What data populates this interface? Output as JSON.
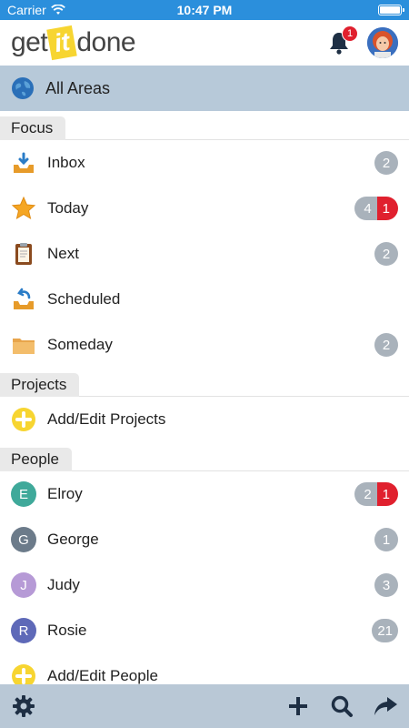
{
  "status_bar": {
    "carrier": "Carrier",
    "time": "10:47 PM"
  },
  "header": {
    "logo_pre": "get",
    "logo_it": "it",
    "logo_post": "done",
    "notification_count": "1"
  },
  "all_areas": {
    "label": "All Areas"
  },
  "focus": {
    "title": "Focus",
    "items": [
      {
        "label": "Inbox",
        "icon": "inbox-icon",
        "count": "2"
      },
      {
        "label": "Today",
        "icon": "star-icon",
        "count": "4",
        "overdue": "1"
      },
      {
        "label": "Next",
        "icon": "clipboard-icon",
        "count": "2"
      },
      {
        "label": "Scheduled",
        "icon": "scheduled-tray-icon",
        "count": ""
      },
      {
        "label": "Someday",
        "icon": "folder-icon",
        "count": "2"
      }
    ]
  },
  "projects": {
    "title": "Projects",
    "add_label": "Add/Edit Projects"
  },
  "people": {
    "title": "People",
    "items": [
      {
        "initial": "E",
        "label": "Elroy",
        "color": "#3fa99a",
        "count": "2",
        "overdue": "1"
      },
      {
        "initial": "G",
        "label": "George",
        "color": "#6c7b8a",
        "count": "1"
      },
      {
        "initial": "J",
        "label": "Judy",
        "color": "#b69ad6",
        "count": "3"
      },
      {
        "initial": "R",
        "label": "Rosie",
        "color": "#5e69b8",
        "count": "21"
      }
    ],
    "add_label": "Add/Edit People"
  },
  "toolbar": {
    "icons": [
      "gear-icon",
      "plus-icon",
      "search-icon",
      "share-arrow-icon"
    ]
  },
  "colors": {
    "status_bar": "#2b8fdc",
    "all_areas_bg": "#b7c9d9",
    "badge_gray": "#a9b2bb",
    "badge_red": "#e0202e",
    "logo_yellow": "#f7d531"
  }
}
